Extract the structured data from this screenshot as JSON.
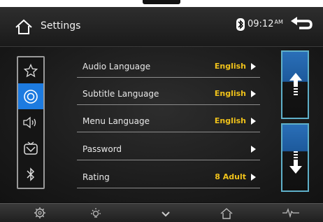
{
  "header": {
    "title": "Settings",
    "time": "09:12",
    "ampm": "AM"
  },
  "sidebar": {
    "items": [
      {
        "icon": "star-icon"
      },
      {
        "icon": "disc-icon",
        "active": true
      },
      {
        "icon": "speaker-icon"
      },
      {
        "icon": "tv-icon"
      },
      {
        "icon": "bluetooth-icon"
      }
    ]
  },
  "settings": {
    "rows": [
      {
        "label": "Audio Language",
        "value": "English"
      },
      {
        "label": "Subtitle Language",
        "value": "English"
      },
      {
        "label": "Menu Language",
        "value": "English"
      },
      {
        "label": "Password",
        "value": ""
      },
      {
        "label": "Rating",
        "value": "8 Adult"
      }
    ]
  },
  "bottom_bar": {
    "items": [
      "gear-icon",
      "brightness-icon",
      "chevron-down-icon",
      "home-icon",
      "equalizer-icon"
    ]
  },
  "colors": {
    "accent": "#1d7be0",
    "value_text": "#f0c21a",
    "scroll_border": "#5fb0c9"
  }
}
